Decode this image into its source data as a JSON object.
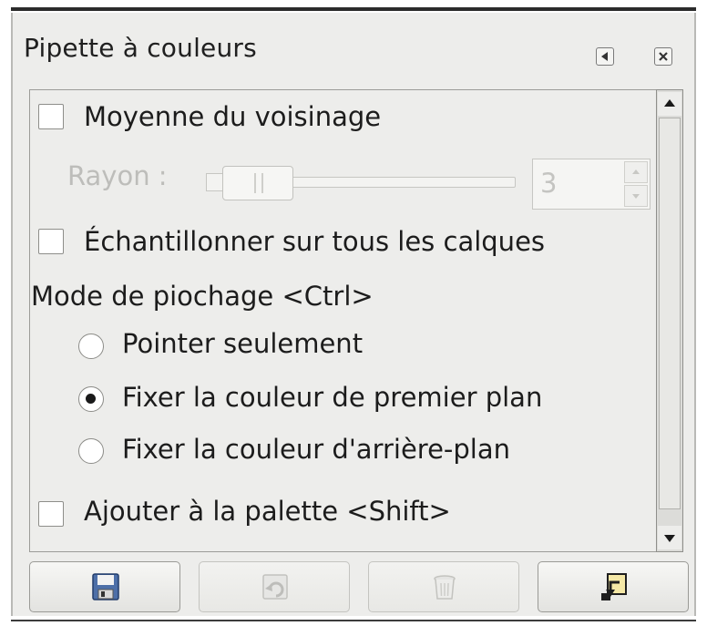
{
  "window": {
    "title": "Pipette à couleurs",
    "menu_icon": "tab-menu-icon",
    "close_icon": "close-icon"
  },
  "options": {
    "sample_average": {
      "label": "Moyenne du voisinage",
      "checked": false
    },
    "radius": {
      "label": "Rayon :",
      "value": "3",
      "enabled": false
    },
    "sample_merged": {
      "label": "Échantillonner sur tous les calques",
      "checked": false
    },
    "pick_mode": {
      "label": "Mode de piochage  <Ctrl>",
      "options": [
        {
          "label": "Pointer seulement",
          "selected": false
        },
        {
          "label": "Fixer la couleur de premier plan",
          "selected": true
        },
        {
          "label": "Fixer la couleur d'arrière-plan",
          "selected": false
        }
      ]
    },
    "add_to_palette": {
      "label": "Ajouter à la palette  <Shift>",
      "checked": false
    }
  },
  "buttons": [
    {
      "icon": "save-icon",
      "enabled": true
    },
    {
      "icon": "restore-icon",
      "enabled": false
    },
    {
      "icon": "delete-icon",
      "enabled": false
    },
    {
      "icon": "reset-icon",
      "enabled": true
    }
  ]
}
